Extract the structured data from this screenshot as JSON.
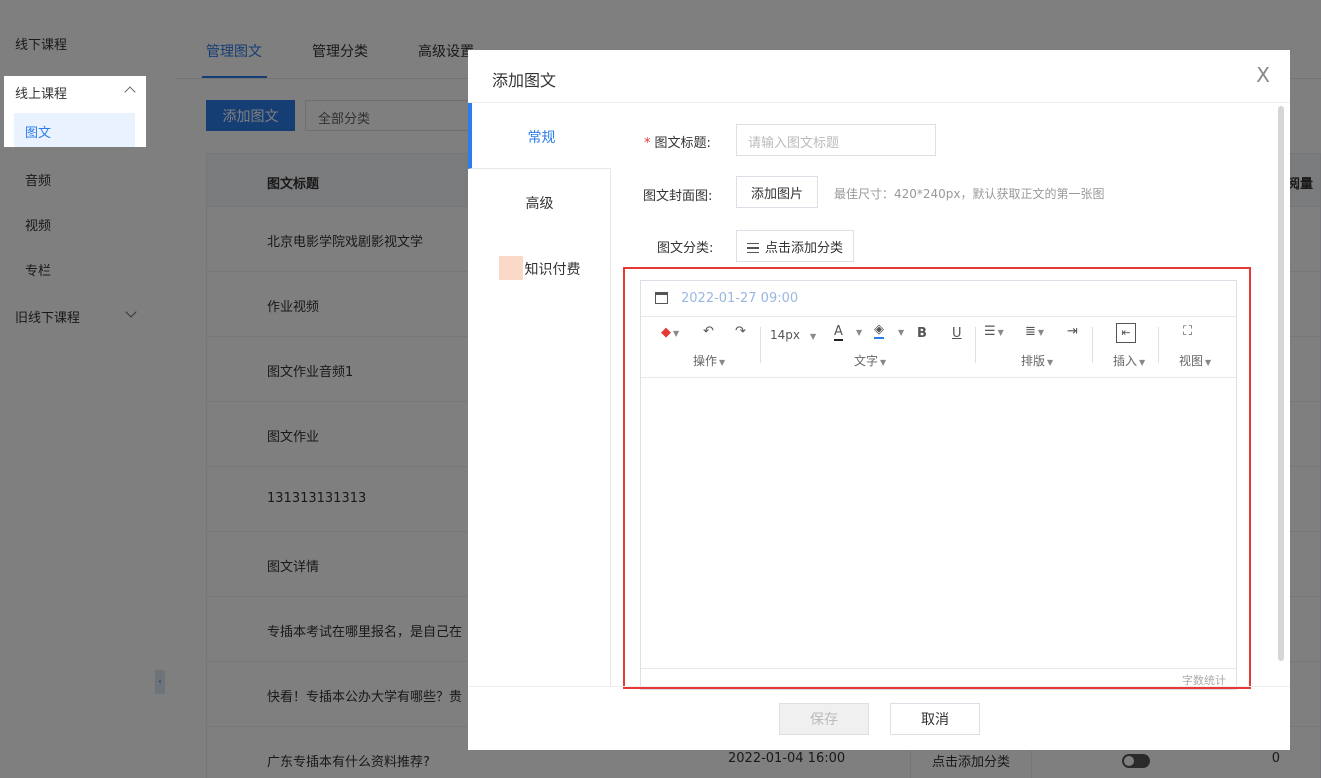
{
  "sidebar": {
    "items": [
      {
        "label": "线下课程"
      },
      {
        "label": "线上课程"
      },
      {
        "label": "图文"
      },
      {
        "label": "音频"
      },
      {
        "label": "视频"
      },
      {
        "label": "专栏"
      },
      {
        "label": "旧线下课程"
      }
    ],
    "collapse_glyph": "‹"
  },
  "main": {
    "tabs": [
      "管理图文",
      "管理分类",
      "高级设置"
    ],
    "add_button": "添加图文",
    "category_filter": "全部分类",
    "table": {
      "headers": {
        "title": "图文标题",
        "views": "阅量"
      },
      "rows": [
        {
          "title": "北京电影学院戏剧影视文学"
        },
        {
          "title": "作业视频"
        },
        {
          "title": "图文作业音频1"
        },
        {
          "title": "图文作业"
        },
        {
          "title": "131313131313"
        },
        {
          "title": "图文详情"
        },
        {
          "title": "专插本考试在哪里报名，是自己在"
        },
        {
          "title": "快看！专插本公办大学有哪些？贵"
        },
        {
          "title": "广东专插本有什么资料推荐?",
          "date": "2022-01-04 16:00",
          "category": "点击添加分类",
          "count": "0"
        }
      ]
    }
  },
  "modal": {
    "title": "添加图文",
    "close": "X",
    "side_tabs": [
      "常规",
      "高级",
      "知识付费"
    ],
    "form": {
      "title_label": "图文标题:",
      "title_placeholder": "请输入图文标题",
      "cover_label": "图文封面图:",
      "cover_button": "添加图片",
      "cover_hint": "最佳尺寸：420*240px，默认获取正文的第一张图",
      "category_label": "图文分类:",
      "category_button": "点击添加分类"
    },
    "editor": {
      "datetime": "2022-01-27 09:00",
      "font_size": "14px",
      "groups": [
        "操作",
        "文字",
        "排版",
        "插入",
        "视图"
      ],
      "word_count": "字数统计"
    },
    "footer": {
      "save": "保存",
      "cancel": "取消"
    }
  }
}
